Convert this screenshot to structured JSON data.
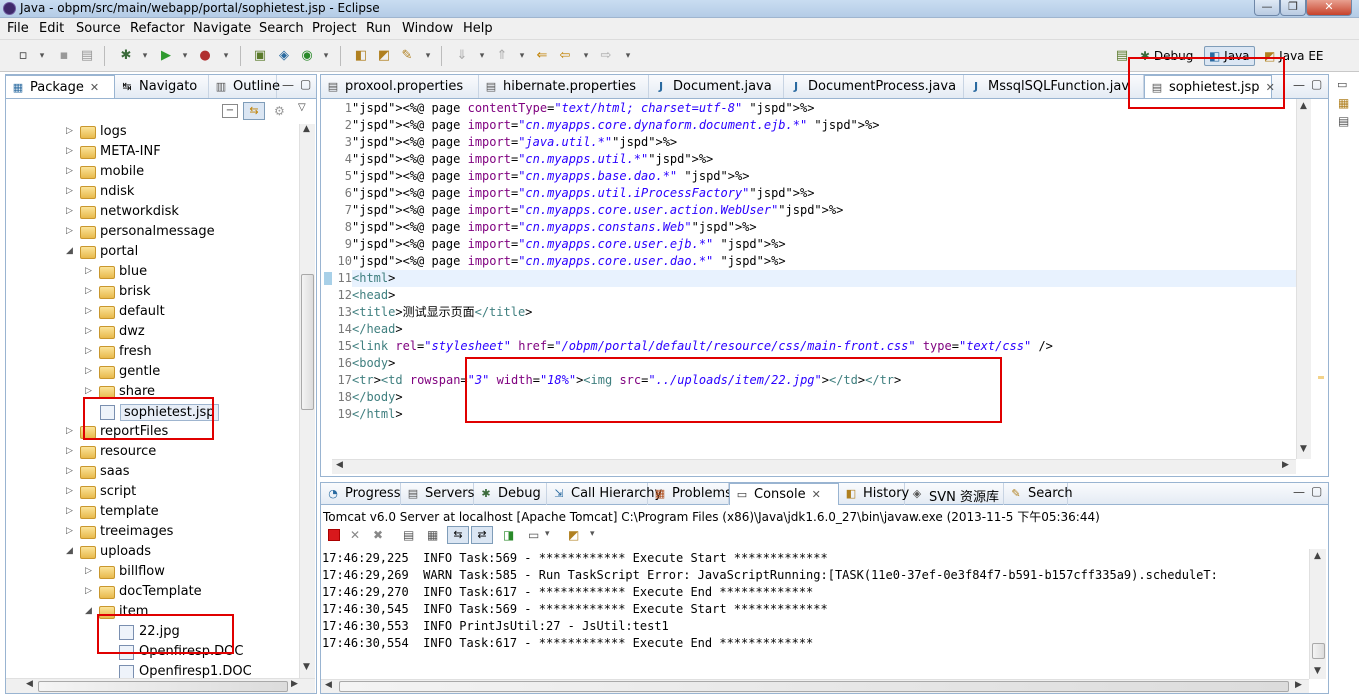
{
  "window": {
    "title": "Java - obpm/src/main/webapp/portal/sophietest.jsp - Eclipse"
  },
  "menu": [
    "File",
    "Edit",
    "Source",
    "Refactor",
    "Navigate",
    "Search",
    "Project",
    "Run",
    "Window",
    "Help"
  ],
  "perspectives": {
    "debug": "Debug",
    "java": "Java",
    "javaee": "Java EE"
  },
  "left_tabs": {
    "package": "Package",
    "navigator": "Navigato",
    "outline": "Outline"
  },
  "tree": [
    {
      "label": "logs",
      "kind": "folder"
    },
    {
      "label": "META-INF",
      "kind": "folder"
    },
    {
      "label": "mobile",
      "kind": "folder"
    },
    {
      "label": "ndisk",
      "kind": "folder"
    },
    {
      "label": "networkdisk",
      "kind": "folder"
    },
    {
      "label": "personalmessage",
      "kind": "folder"
    },
    {
      "label": "portal",
      "kind": "folder"
    },
    {
      "label": "blue",
      "kind": "folder"
    },
    {
      "label": "brisk",
      "kind": "folder"
    },
    {
      "label": "default",
      "kind": "folder"
    },
    {
      "label": "dwz",
      "kind": "folder"
    },
    {
      "label": "fresh",
      "kind": "folder"
    },
    {
      "label": "gentle",
      "kind": "folder"
    },
    {
      "label": "share",
      "kind": "folder"
    },
    {
      "label": "sophietest.jsp",
      "kind": "file"
    },
    {
      "label": "reportFiles",
      "kind": "folder"
    },
    {
      "label": "resource",
      "kind": "folder"
    },
    {
      "label": "saas",
      "kind": "folder"
    },
    {
      "label": "script",
      "kind": "folder"
    },
    {
      "label": "template",
      "kind": "folder"
    },
    {
      "label": "treeimages",
      "kind": "folder"
    },
    {
      "label": "uploads",
      "kind": "folder"
    },
    {
      "label": "billflow",
      "kind": "folder"
    },
    {
      "label": "docTemplate",
      "kind": "folder"
    },
    {
      "label": "item",
      "kind": "folder"
    },
    {
      "label": "22.jpg",
      "kind": "file"
    },
    {
      "label": "Openfiresp.DOC",
      "kind": "file"
    },
    {
      "label": "Openfiresp1.DOC",
      "kind": "file"
    }
  ],
  "editor_tabs": [
    "proxool.properties",
    "hibernate.properties",
    "Document.java",
    "DocumentProcess.java",
    "MssqlSQLFunction.jav",
    "sophietest.jsp"
  ],
  "code_lines": [
    "<%@ page contentType=\"text/html; charset=utf-8\" %>",
    "<%@ page import=\"cn.myapps.core.dynaform.document.ejb.*\" %>",
    "<%@ page import=\"java.util.*\"%>",
    "<%@ page import=\"cn.myapps.util.*\"%>",
    "<%@ page import=\"cn.myapps.base.dao.*\" %>",
    "<%@ page import=\"cn.myapps.util.iProcessFactory\"%>",
    "<%@ page import=\"cn.myapps.core.user.action.WebUser\"%>",
    "<%@ page import=\"cn.myapps.constans.Web\"%>",
    "<%@ page import=\"cn.myapps.core.user.ejb.*\" %>",
    "<%@ page import=\"cn.myapps.core.user.dao.*\" %>",
    "<html>",
    "<head>",
    "<title>测试显示页面</title>",
    "</head>",
    "<link rel=\"stylesheet\" href=\"/obpm/portal/default/resource/css/main-front.css\" type=\"text/css\" />",
    "<body>",
    "<tr><td rowspan=\"3\" width=\"18%\"><img src=\"../uploads/item/22.jpg\"></td></tr>",
    "</body>",
    "</html>"
  ],
  "bottom_tabs": [
    "Progress",
    "Servers",
    "Debug",
    "Call Hierarchy",
    "Problems",
    "Console",
    "History",
    "SVN 资源库",
    "Search"
  ],
  "console": {
    "header": "Tomcat v6.0 Server at localhost [Apache Tomcat] C:\\Program Files (x86)\\Java\\jdk1.6.0_27\\bin\\javaw.exe (2013-11-5 下午05:36:44)",
    "lines": [
      "17:46:29,225  INFO Task:569 - ************ Execute Start *************",
      "17:46:29,269  WARN Task:585 - Run TaskScript Error: JavaScriptRunning:[TASK(11e0-37ef-0e3f84f7-b591-b157cff335a9).scheduleT:",
      "17:46:29,270  INFO Task:617 - ************ Execute End *************",
      "17:46:30,545  INFO Task:569 - ************ Execute Start *************",
      "17:46:30,553  INFO PrintJsUtil:27 - JsUtil:test1",
      "17:46:30,554  INFO Task:617 - ************ Execute End *************"
    ]
  }
}
